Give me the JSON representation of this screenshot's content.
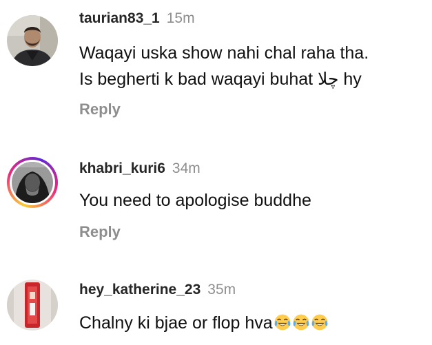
{
  "comments": [
    {
      "username": "taurian83_1",
      "time": "15m",
      "line1": "Waqayi uska show nahi chal raha tha.",
      "line2": "Is  begherti k bad waqayi buhat چلا hy",
      "reply": "Reply"
    },
    {
      "username": "khabri_kuri6",
      "time": "34m",
      "line1": "You need to apologise buddhe",
      "reply": "Reply"
    },
    {
      "username": "hey_katherine_23",
      "time": "35m",
      "line1": "Chalny ki bjae or flop hva",
      "emojis": [
        "tears-of-joy-emoji",
        "tears-of-joy-emoji",
        "tears-of-joy-emoji"
      ]
    }
  ],
  "colors": {
    "username": "#262626",
    "timestamp": "#8e8e8e",
    "reply": "#8e8e8e",
    "text": "#111111",
    "story_ring": "#ee2a7b"
  }
}
